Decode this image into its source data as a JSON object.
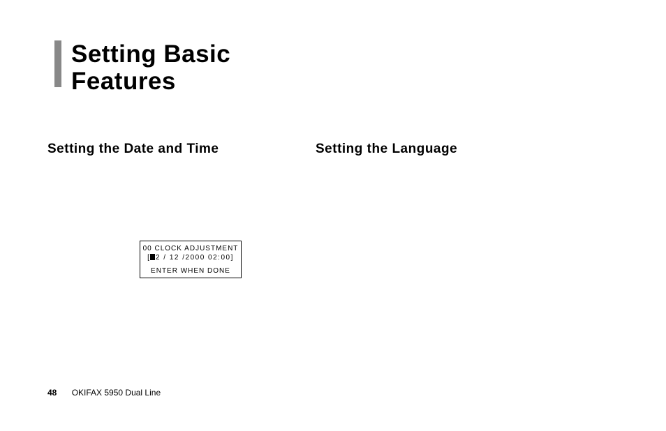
{
  "heading": {
    "title_line1": "Setting Basic",
    "title_line2": "Features"
  },
  "sections": {
    "left": "Setting the Date and Time",
    "right": "Setting the Language"
  },
  "lcd": {
    "line1": "00  CLOCK  ADJUSTMENT",
    "line2_prefix": "[",
    "line2_after_cursor": "2 / 12 /2000  02:00]",
    "line3": "ENTER  WHEN  DONE"
  },
  "footer": {
    "page_number": "48",
    "product": "OKIFAX 5950 Dual Line"
  }
}
